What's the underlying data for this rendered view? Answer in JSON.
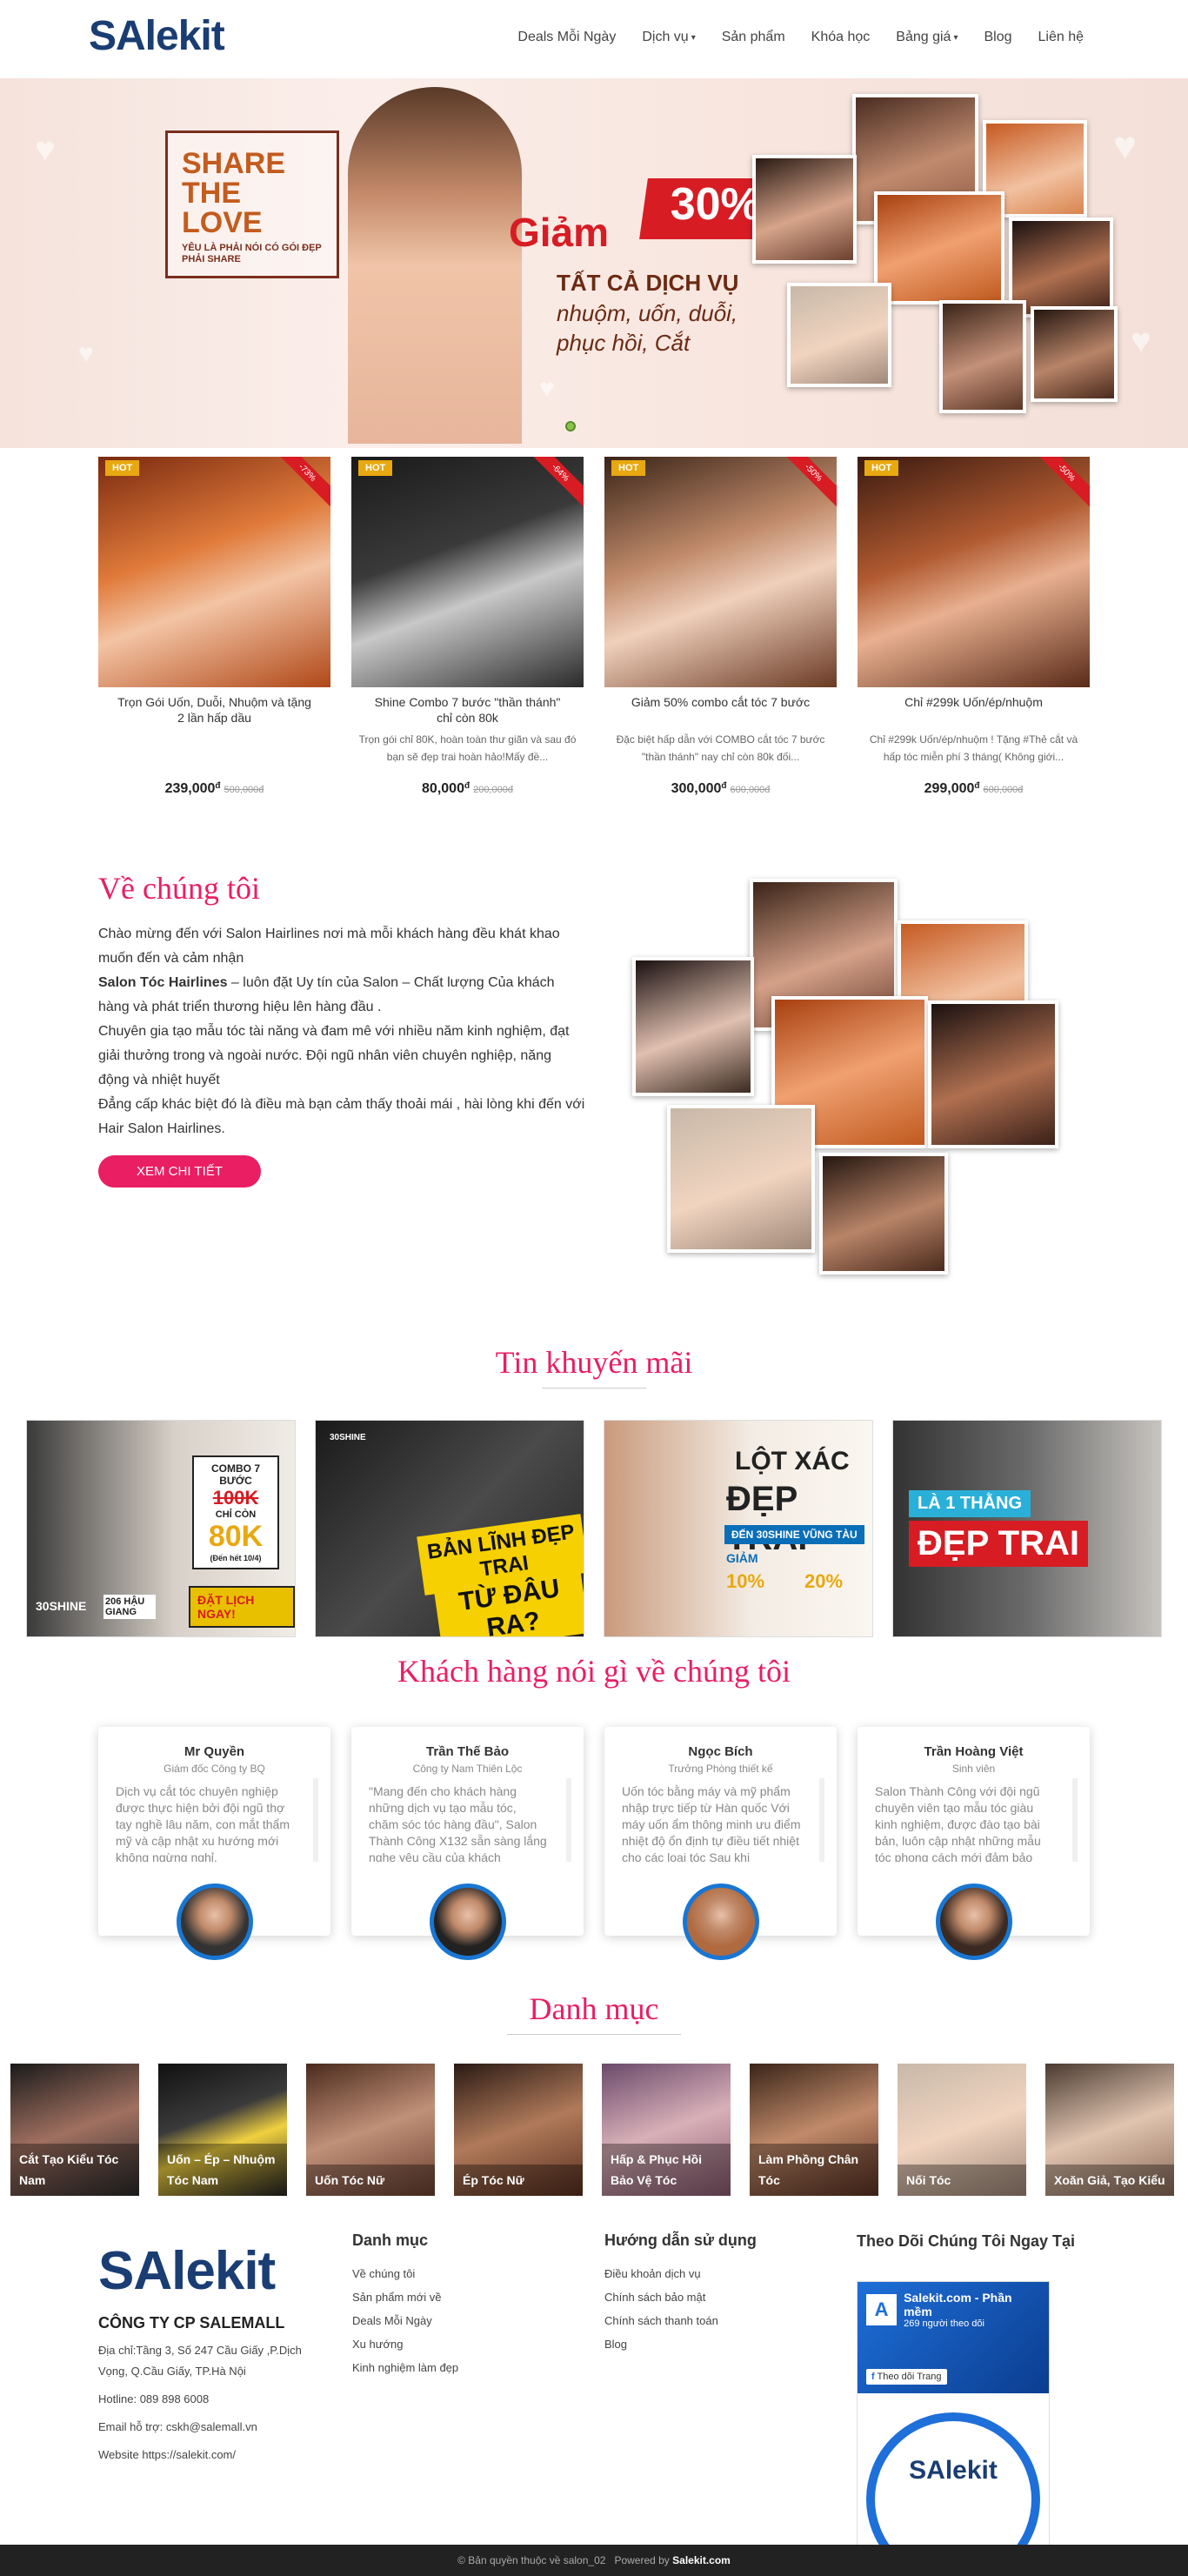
{
  "brand": {
    "logo": "SAlekit"
  },
  "nav": [
    {
      "label": "Deals Mỗi Ngày",
      "dropdown": false
    },
    {
      "label": "Dịch vụ",
      "dropdown": true
    },
    {
      "label": "Sản phẩm",
      "dropdown": false
    },
    {
      "label": "Khóa học",
      "dropdown": false
    },
    {
      "label": "Bảng giá",
      "dropdown": true
    },
    {
      "label": "Blog",
      "dropdown": false
    },
    {
      "label": "Liên hệ",
      "dropdown": false
    }
  ],
  "hero": {
    "share_title": "SHARE THE LOVE",
    "share_sub": "YÊU LÀ PHẢI NÓI CÓ GÓI ĐẸP PHẢI SHARE",
    "discount_label": "Giảm",
    "discount_value": "30%",
    "services_title": "TẤT CẢ DỊCH VỤ",
    "services_list": "nhuộm, uốn, duỗi, phục hồi, Cắt"
  },
  "products": [
    {
      "name": "Trọn Gói Uốn, Duỗi, Nhuộm và tặng 2 lần hấp dầu",
      "desc": "",
      "price": "239,000",
      "currency": "đ",
      "old": "500,000đ",
      "ribbon": "-73%",
      "badge": "HOT"
    },
    {
      "name": "Shine Combo 7 bước \"thần thánh\" chỉ còn 80k",
      "desc": "Trọn gói chỉ 80K, hoàn toàn thư giãn và sau đó bạn sẽ đẹp trai hoàn hảo!Mấy đề...",
      "price": "80,000",
      "currency": "đ",
      "old": "200,000đ",
      "ribbon": "-64%",
      "badge": "HOT"
    },
    {
      "name": "Giảm 50% combo cắt tóc 7 bước",
      "desc": "Đặc biệt hấp dẫn với COMBO cắt tóc 7 bước \"thần thánh\" nay chỉ còn 80k đối...",
      "price": "300,000",
      "currency": "đ",
      "old": "600,000đ",
      "ribbon": "-50%",
      "badge": "HOT"
    },
    {
      "name": "Chỉ #299k Uốn/ép/nhuộm",
      "desc": "Chỉ #299k Uốn/ép/nhuộm ! Tặng #Thẻ cắt và hấp tóc miễn phí 3 tháng( Không giới...",
      "price": "299,000",
      "currency": "đ",
      "old": "600,000đ",
      "ribbon": "-50%",
      "badge": "HOT"
    }
  ],
  "about": {
    "title": "Về chúng tôi",
    "p1": "Chào mừng đến với Salon Hairlines nơi mà mỗi khách hàng đều khát khao muốn đến và cảm nhận",
    "p2_bold": "Salon Tóc Hairlines",
    "p2": " – luôn đặt Uy tín của Salon – Chất lượng Của khách hàng và phát triển thương hiệu lên hàng đầu .",
    "p3": "Chuyên gia tạo mẫu tóc tài năng và đam mê với nhiều năm kinh nghiệm, đạt giải thưởng trong và ngoài nước. Đội ngũ nhân viên chuyên nghiệp, năng động và nhiệt huyết",
    "p4": "Đẳng cấp khác biệt đó là điều mà bạn cảm thấy thoải mái , hài lòng khi đến với Hair Salon Hairlines.",
    "button": "XEM CHI TIẾT"
  },
  "promos_title": "Tin khuyến mãi",
  "promos": [
    {
      "line1": "COMBO 7 BƯỚC",
      "line2": "100K",
      "line3": "CHỈ CÒN",
      "line4": "80K",
      "line5": "(Đến hết 10/4)",
      "cta": "ĐẶT LỊCH NGAY!",
      "brand": "30SHINE",
      "addr": "206 HẬU GIANG"
    },
    {
      "line1": "BẢN LĨNH ĐẸP TRAI",
      "line2": "TỪ ĐÂU RA?",
      "brand": "30SHINE"
    },
    {
      "line1": "LỘT XÁC",
      "line2": "ĐẸP TRAI",
      "line3": "ĐẾN 30SHINE VŨNG TÀU",
      "line4": "GIẢM",
      "p1": "10%",
      "p2": "20%"
    },
    {
      "line1": "LÀ 1 THẰNG",
      "line2": "ĐẸP TRAI"
    }
  ],
  "testimonials_title": "Khách hàng nói gì về chúng tôi",
  "testimonials": [
    {
      "name": "Mr Quyền",
      "role": "Giám đốc Công ty BQ",
      "text": "Dịch vụ cắt tóc chuyên nghiệp được thực hiện bởi đội ngũ thợ tay nghề lâu năm, con mắt thẩm mỹ và cập nhật xu hướng mới không ngừng nghỉ."
    },
    {
      "name": "Trần Thế Bảo",
      "role": "Công ty Nam Thiên Lộc",
      "text": "\"Mang đến cho khách hàng những dịch vụ tạo mẫu tóc, chăm sóc tóc hàng đầu\", Salon Thành Công X132 sẵn sàng lắng nghe yêu cầu của khách"
    },
    {
      "name": "Ngọc Bích",
      "role": "Trưởng Phòng thiết kế",
      "text": "Uốn tóc bằng máy và mỹ phẩm nhập trực tiếp từ Hàn quốc Với máy uốn ẩm thông minh ưu điểm nhiệt độ ổn định tự điều tiết nhiệt cho các loại tóc Sau khi"
    },
    {
      "name": "Trần Hoàng Việt",
      "role": "Sinh viên",
      "text": "Salon Thành Công với đội ngũ chuyên viên tạo mẫu tóc giàu kinh nghiệm, được đào tạo bài bản, luôn cập nhật những mẫu tóc phong cách mới đảm bảo"
    }
  ],
  "categories_title": "Danh mục",
  "categories": [
    {
      "label": "Cắt Tạo Kiểu Tóc Nam"
    },
    {
      "label": "Uốn – Ép – Nhuộm Tóc Nam"
    },
    {
      "label": "Uốn Tóc Nữ"
    },
    {
      "label": "Ép Tóc Nữ"
    },
    {
      "label": "Hấp & Phục Hồi Bảo Vệ Tóc"
    },
    {
      "label": "Làm Phồng Chân Tóc"
    },
    {
      "label": "Nối Tóc"
    },
    {
      "label": "Xoăn Giả, Tạo Kiểu"
    }
  ],
  "footer": {
    "logo": "SAlekit",
    "company": "CÔNG TY CP SALEMALL",
    "address": "Địa chỉ:Tầng 3, Số 247 Cầu Giấy ,P.Dịch Vọng, Q.Cầu Giấy, TP.Hà Nội",
    "hotline": "Hotline: 089 898 6008",
    "email": "Email hỗ trợ: cskh@salemall.vn",
    "website": "Website https://salekit.com/",
    "col1_title": "Danh mục",
    "col1": [
      "Về chúng tôi",
      "Sản phẩm mới về",
      "Deals Mỗi Ngày",
      "Xu hướng",
      "Kinh nghiệm làm đẹp"
    ],
    "col2_title": "Hướng dẫn sử dụng",
    "col2": [
      "Điều khoản dịch vụ",
      "Chính sách bảo mật",
      "Chính sách thanh toán",
      "Blog"
    ],
    "col3_title": "Theo Dõi Chúng Tôi Ngay Tại",
    "fb_page": "Salekit.com - Phần mềm",
    "fb_followers": "269 người theo dõi",
    "fb_follow_btn": "Theo dõi Trang",
    "fb_logo": "SAlekit"
  },
  "copyright": {
    "text": "© Bản quyền thuộc về salon_02",
    "powered": "Powered by",
    "brand": "Salekit.com"
  },
  "colors": {
    "accent": "#e91e63",
    "brand": "#1a3d73",
    "hot": "#e8a810",
    "ribbon": "#d71c24"
  }
}
